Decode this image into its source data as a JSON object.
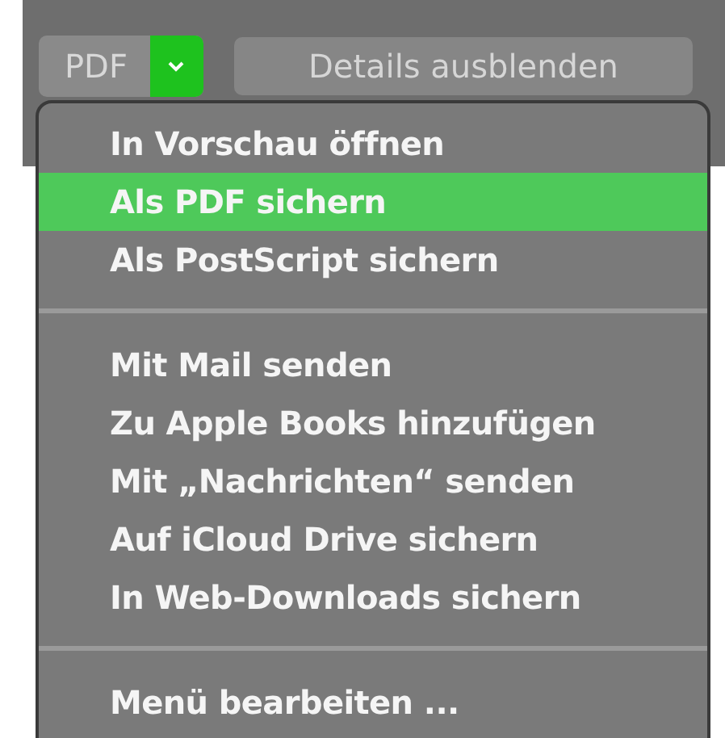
{
  "toolbar": {
    "format_popup": {
      "label": "PDF",
      "open": true
    },
    "details_button": {
      "label": "Details ausblenden"
    }
  },
  "menu": {
    "items": [
      {
        "kind": "item",
        "label": "In Vorschau öffnen",
        "selected": false
      },
      {
        "kind": "item",
        "label": "Als PDF sichern",
        "selected": true
      },
      {
        "kind": "item",
        "label": "Als PostScript sichern",
        "selected": false
      },
      {
        "kind": "separator"
      },
      {
        "kind": "item",
        "label": "Mit Mail senden",
        "selected": false
      },
      {
        "kind": "item",
        "label": "Zu Apple Books hinzufügen",
        "selected": false
      },
      {
        "kind": "item",
        "label": "Mit „Nachrichten“ senden",
        "selected": false
      },
      {
        "kind": "item",
        "label": "Auf iCloud Drive sichern",
        "selected": false
      },
      {
        "kind": "item",
        "label": "In Web-Downloads sichern",
        "selected": false
      },
      {
        "kind": "separator"
      },
      {
        "kind": "item",
        "label": "Menü bearbeiten ...",
        "selected": false
      }
    ]
  }
}
